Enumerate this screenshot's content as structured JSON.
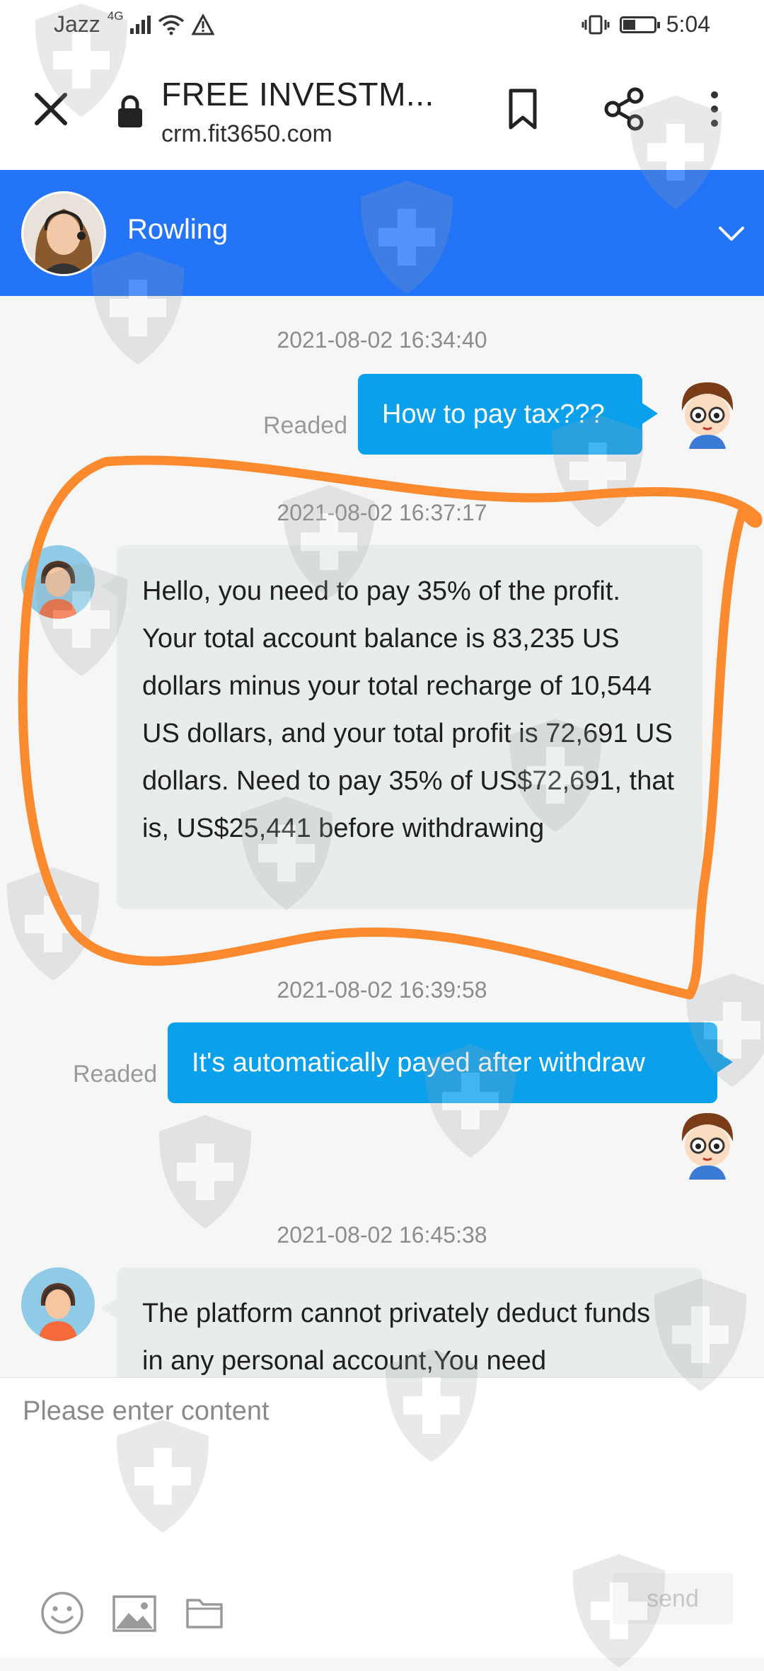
{
  "status_bar": {
    "carrier": "Jazz",
    "network": "4G",
    "time": "5:04",
    "battery_level": 0.4
  },
  "browser": {
    "page_title": "FREE INVESTM...",
    "url": "crm.fit3650.com"
  },
  "chat": {
    "agent_name": "Rowling",
    "messages": [
      {
        "timestamp": "2021-08-02 16:34:40",
        "direction": "outgoing",
        "text": "How to pay tax???",
        "status": "Readed"
      },
      {
        "timestamp": "2021-08-02 16:37:17",
        "direction": "incoming",
        "text": "Hello, you need to pay 35% of the profit. Your total account balance is 83,235 US dollars minus your total recharge of 10,544 US dollars, and your total profit is 72,691 US dollars. Need to pay 35% of US$72,691, that is, US$25,441 before withdrawing"
      },
      {
        "timestamp": "2021-08-02 16:39:58",
        "direction": "outgoing",
        "text": "It's automatically payed after withdraw",
        "status": "Readed"
      },
      {
        "timestamp": "2021-08-02 16:45:38",
        "direction": "incoming",
        "text": "The platform cannot privately deduct funds in any personal account,You need"
      }
    ]
  },
  "composer": {
    "placeholder": "Please enter content",
    "send_label": "send"
  },
  "colors": {
    "header_blue": "#2374f7",
    "outgoing_bubble": "#0aa0ec",
    "incoming_bubble": "#e9ecec",
    "annotation_orange": "#fb8a2e"
  },
  "icons": [
    "close-icon",
    "lock-icon",
    "bookmark-icon",
    "share-icon",
    "more-vertical-icon",
    "chevron-down-icon",
    "emoji-icon",
    "image-icon",
    "folder-icon",
    "shield-cross-watermark-icon"
  ]
}
